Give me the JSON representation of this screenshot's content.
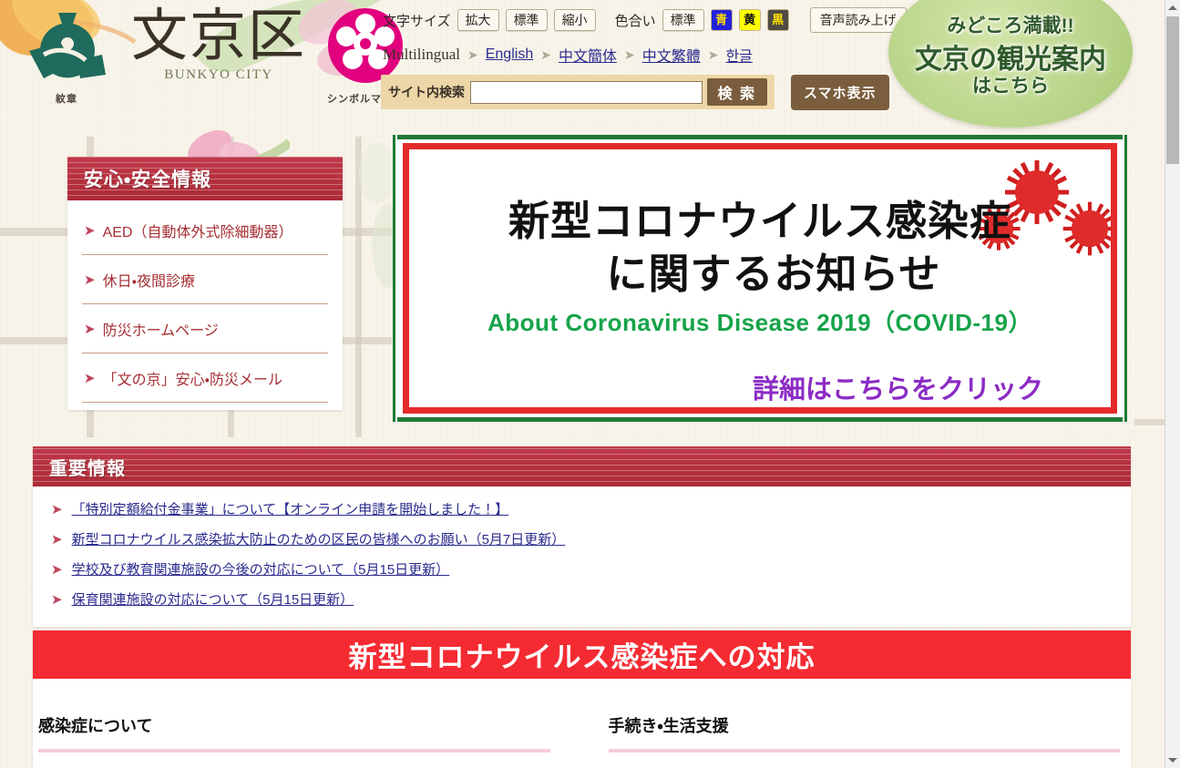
{
  "site": {
    "crest_caption": "紋章",
    "title": "文京区",
    "title_en": "BUNKYO CITY",
    "symbol_caption": "シンボルマーク"
  },
  "a11y": {
    "font_size_label": "文字サイズ",
    "font_buttons": [
      "拡大",
      "標準",
      "縮小"
    ],
    "color_label": "色合い",
    "color_default": "標準",
    "color_blue": "青",
    "color_yellow": "黄",
    "color_black": "黒",
    "speech_button": "音声読み上げ"
  },
  "multilingual": {
    "label": "Multilingual",
    "links": [
      "English",
      "中文簡体",
      "中文繁體",
      "한글"
    ]
  },
  "search": {
    "label": "サイト内検索",
    "value": "",
    "placeholder": "",
    "button": "検 索",
    "smartphone_button": "スマホ表示"
  },
  "tourism": {
    "line1": "みどころ満載!!",
    "line2": "文京の観光案内",
    "line3": "はこちら"
  },
  "safety": {
    "heading": "安心・安全情報",
    "items": [
      "AED（自動体外式除細動器）",
      "休日・夜間診療",
      "防災ホームページ",
      "「文の京」安心・防災メール"
    ]
  },
  "covid_banner": {
    "heading_line1": "新型コロナウイルス感染症",
    "heading_line2": "に関するお知らせ",
    "subtitle_en": "About Coronavirus Disease 2019（COVID-19）",
    "cta": "詳細はこちらをクリック"
  },
  "important": {
    "heading": "重要情報",
    "items": [
      "「特別定額給付金事業」について【オンライン申請を開始しました！】",
      "新型コロナウイルス感染拡大防止のための区民の皆様へのお願い（5月7日更新）",
      "学校及び教育関連施設の今後の対応について（5月15日更新）",
      "保育関連施設の対応について（5月15日更新）"
    ]
  },
  "response": {
    "heading": "新型コロナウイルス感染症への対応",
    "columns": [
      "感染症について",
      "手続き・生活支援"
    ]
  },
  "colors": {
    "panel_red": "#b6313f",
    "banner_red": "#f42b32",
    "link_blue": "#2b2b8f",
    "safety_link": "#a62f34",
    "crest_green": "#1f6b5e",
    "symbol_pink": "#e2007f",
    "covid_green": "#16a34a",
    "covid_purple": "#8b2bc4",
    "page_bg": "#f5f0e3"
  }
}
